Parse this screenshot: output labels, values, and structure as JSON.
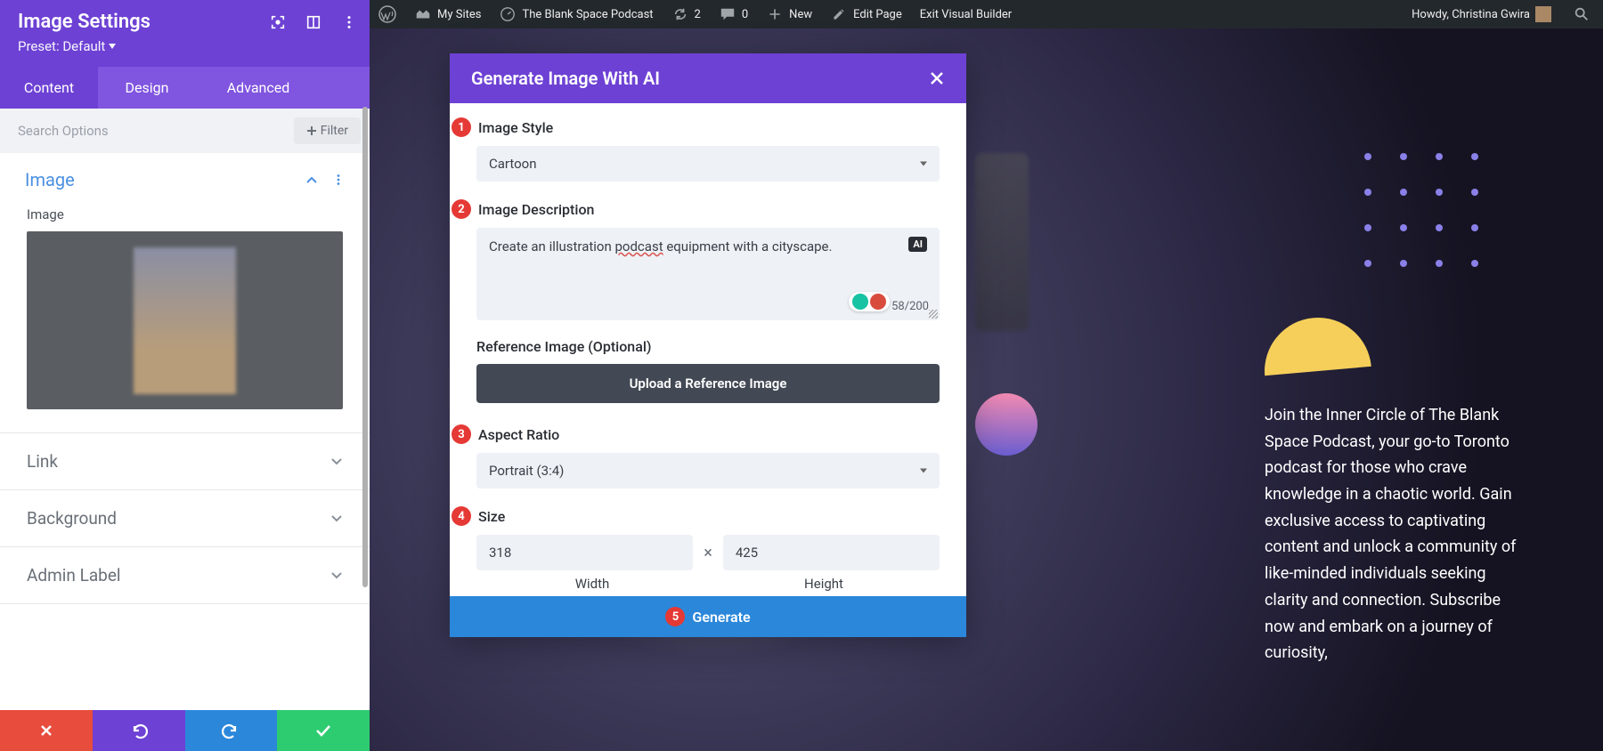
{
  "admin_bar": {
    "my_sites": "My Sites",
    "site_name": "The Blank Space Podcast",
    "refresh_count": "2",
    "comments_count": "0",
    "new_label": "New",
    "edit_page": "Edit Page",
    "exit_vb": "Exit Visual Builder",
    "howdy": "Howdy, Christina Gwira"
  },
  "panel": {
    "title": "Image Settings",
    "preset": "Preset: Default",
    "tabs": {
      "content": "Content",
      "design": "Design",
      "advanced": "Advanced"
    },
    "search_placeholder": "Search Options",
    "filter": "Filter",
    "section_image": "Image",
    "image_label": "Image",
    "acc": {
      "link": "Link",
      "background": "Background",
      "admin_label": "Admin Label"
    }
  },
  "modal": {
    "title": "Generate Image With AI",
    "style_label": "Image Style",
    "style_value": "Cartoon",
    "desc_label": "Image Description",
    "desc_pre": "Create an illustration ",
    "desc_spell": "podcast",
    "desc_post": " equipment with a cityscape.",
    "char_count": "58/200",
    "ai_badge": "AI",
    "ref_label": "Reference Image (Optional)",
    "upload_label": "Upload a Reference Image",
    "aspect_label": "Aspect Ratio",
    "aspect_value": "Portrait (3:4)",
    "size_label": "Size",
    "width_value": "318",
    "height_value": "425",
    "width_label": "Width",
    "height_label": "Height",
    "generate": "Generate",
    "steps": {
      "s1": "1",
      "s2": "2",
      "s3": "3",
      "s4": "4",
      "s5": "5"
    }
  },
  "page_text": "Join the Inner Circle of The Blank Space Podcast, your go-to Toronto podcast for those who crave knowledge in a chaotic world. Gain exclusive access to captivating content and unlock a community of like-minded individuals seeking clarity and connection. Subscribe now and embark on a journey of curiosity,"
}
